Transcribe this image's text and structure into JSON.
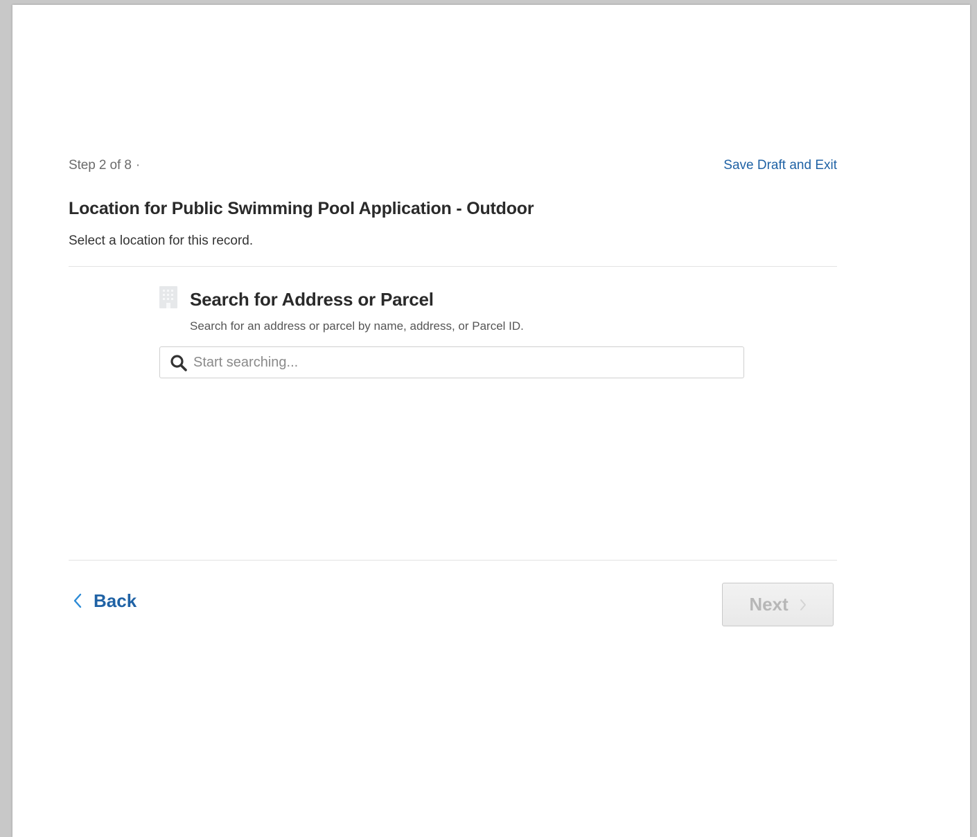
{
  "header": {
    "step_text": "Step 2 of 8",
    "step_separator": "·",
    "save_draft_label": "Save Draft and Exit"
  },
  "page": {
    "title": "Location for Public Swimming Pool Application - Outdoor",
    "subtitle": "Select a location for this record."
  },
  "search": {
    "heading": "Search for Address or Parcel",
    "description": "Search for an address or parcel by name, address, or Parcel ID.",
    "placeholder": "Start searching...",
    "value": "",
    "icon": "building-icon"
  },
  "footer": {
    "back_label": "Back",
    "next_label": "Next",
    "next_disabled": true
  },
  "colors": {
    "link": "#1f62a5",
    "text": "#2a2a2a",
    "muted": "#6b6b6b",
    "disabled": "#b7b7b7"
  }
}
